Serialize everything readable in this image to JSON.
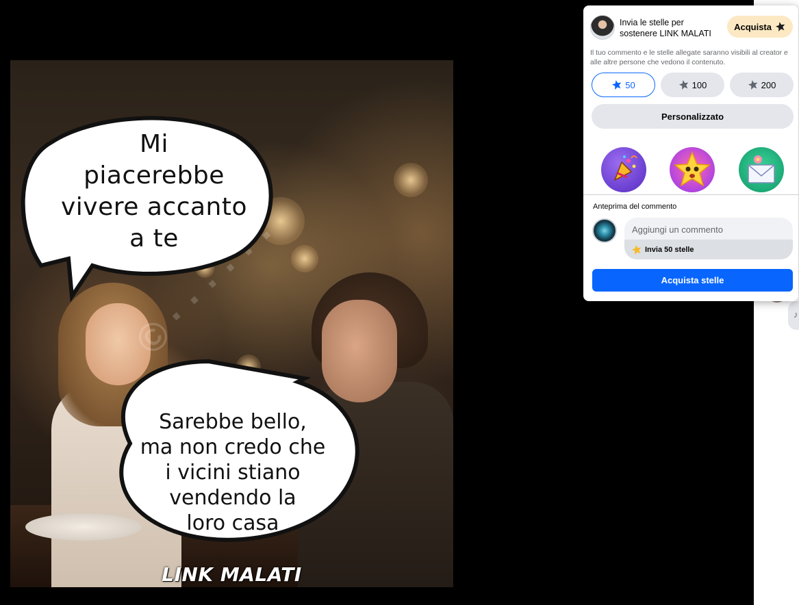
{
  "post": {
    "bubble_top_lines": [
      "Mi",
      "piacerebbe",
      "vivere accanto",
      "a te"
    ],
    "bubble_bottom_lines": [
      "Sarebbe bello,",
      "ma non credo che",
      "i vicini stiano",
      "vendendo la",
      "loro casa"
    ],
    "brand_caption": "LINK MALATI"
  },
  "popup": {
    "header_text": "Invia le stelle per sostenere LINK MALATI",
    "buy_pill_label": "Acquista",
    "disclaimer": "Il tuo commento e le stelle allegate saranno visibili al creator e alle altre persone che vedono il contenuto.",
    "amounts": [
      {
        "label": "50",
        "selected": true
      },
      {
        "label": "100",
        "selected": false
      },
      {
        "label": "200",
        "selected": false
      }
    ],
    "custom_label": "Personalizzato",
    "stickers": [
      "party-popper-sticker",
      "star-face-sticker",
      "envelope-flower-sticker"
    ],
    "preview_label": "Anteprima del commento",
    "comment_placeholder": "Aggiungi un commento",
    "comment_stars_label": "Invia 50 stelle",
    "buy_stars_button": "Acquista stelle"
  },
  "colors": {
    "primary_blue": "#0866ff",
    "pill_bg": "#fce9c3",
    "star_gold": "#f7b928",
    "button_gray": "#e4e6eb"
  }
}
